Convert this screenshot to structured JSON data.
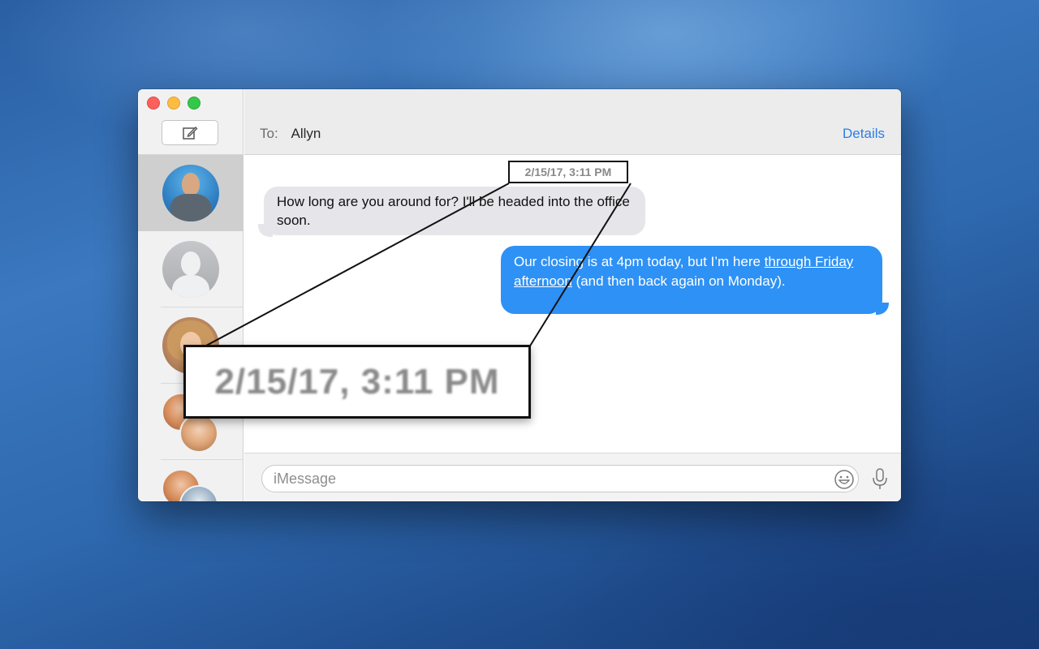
{
  "window": {
    "controls": [
      "close",
      "minimize",
      "zoom"
    ]
  },
  "sidebar": {
    "compose_icon": "compose-icon",
    "conversations": [
      {
        "avatar": "person-photo",
        "selected": true
      },
      {
        "avatar": "generic-person-icon",
        "selected": false
      },
      {
        "avatar": "person-photo",
        "selected": false
      },
      {
        "avatar": "group-photo",
        "selected": false
      },
      {
        "avatar": "group-photo",
        "selected": false
      }
    ]
  },
  "header": {
    "to_label": "To:",
    "recipient": "Allyn",
    "details_label": "Details"
  },
  "conversation": {
    "timestamp": "2/15/17, 3:11 PM",
    "messages": [
      {
        "direction": "incoming",
        "text": "How long are you around for? I'll be headed into the office soon."
      },
      {
        "direction": "outgoing",
        "text_before": "Our closing is at 4pm today, but I’m here ",
        "link_text": "through Friday afternoon",
        "text_after": " (and then back again on Monday)."
      }
    ]
  },
  "composer": {
    "placeholder": "iMessage",
    "value": "",
    "emoji_icon": "emoji-icon",
    "mic_icon": "microphone-icon"
  },
  "callout": {
    "zoom_text": "2/15/17, 3:11 PM"
  },
  "colors": {
    "outgoing_bubble": "#2e91f5",
    "incoming_bubble": "#e5e5ea",
    "accent": "#2a7ee6"
  }
}
